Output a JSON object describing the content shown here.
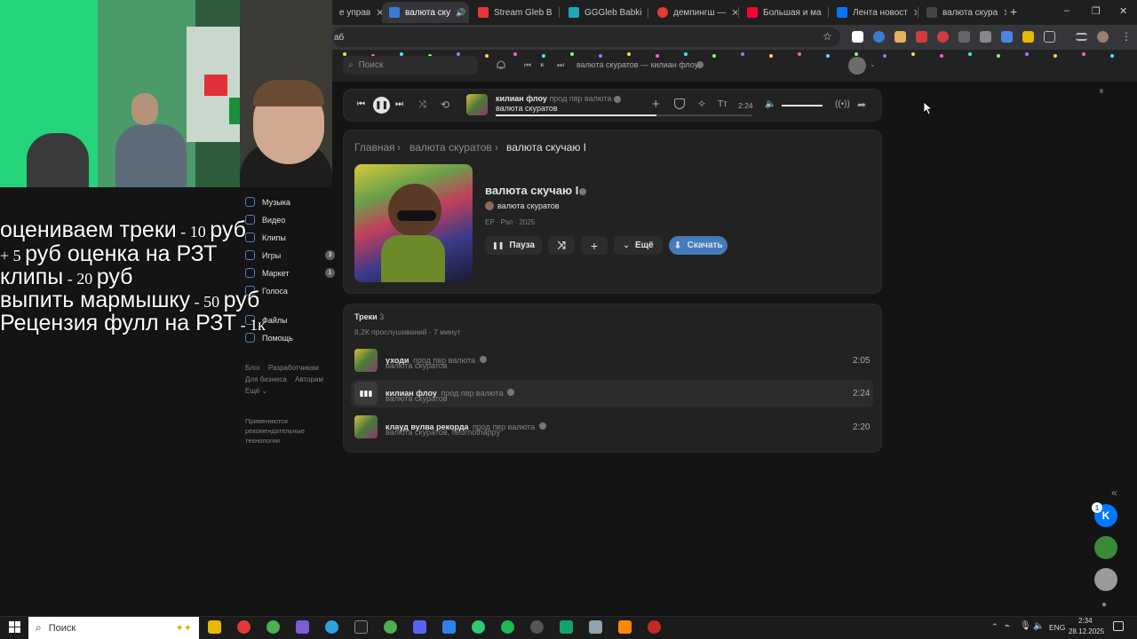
{
  "browser": {
    "tabs": [
      {
        "label": "е управ",
        "color": "#ffffff"
      },
      {
        "label": "валюта ску",
        "color": "#3a7bd5",
        "active": true
      },
      {
        "label": "Stream Gleb B",
        "color": "#e53935"
      },
      {
        "label": "GGGleb Babki",
        "color": "#1ea7b8"
      },
      {
        "label": "демпингш — ",
        "color": "#e53935"
      },
      {
        "label": "Большая и ма",
        "color": "#ff0033"
      },
      {
        "label": "Лента новост",
        "color": "#0077ff"
      },
      {
        "label": "валюта скура",
        "color": "#dddddd"
      }
    ],
    "new_tab": "+",
    "address": "аб",
    "window_controls": {
      "minimize": "–",
      "maximize": "❐",
      "close": "✕"
    }
  },
  "header": {
    "search_placeholder": "Поиск",
    "now_playing": "валюта скуратов — килиан флоу"
  },
  "player": {
    "title": "килиан флоу",
    "subtitle": "прод пвр валюта",
    "artist": "валюта скуратов",
    "time": "2:24",
    "tt_label": "Tт",
    "progress": 0.63,
    "volume": 1.0
  },
  "breadcrumb": {
    "home": "Главная",
    "artist": "валюта скуратов",
    "current": "валюта скучаю I"
  },
  "album": {
    "title": "валюта скучаю I",
    "artist": "валюта скуратов",
    "meta": "EP · Рэп · 2025",
    "pause_label": "Пауза",
    "more_label": "Ещё",
    "download_label": "Скачать"
  },
  "tracks": {
    "header": "Треки",
    "count": "3",
    "stats": "8,2К прослушиваний · 7 минут",
    "items": [
      {
        "title": "уходи",
        "feat": "прод пвр валюта",
        "artist": "валюта скуратов",
        "duration": "2:05"
      },
      {
        "title": "килиан флоу",
        "feat": "прод пвр валюта",
        "artist": "валюта скуратов",
        "duration": "2:24",
        "playing": true
      },
      {
        "title": "клауд вулва рекорда",
        "feat": "прод пвр валюта",
        "artist": "валюта скуратов, fleurnothappy",
        "duration": "2:20"
      }
    ]
  },
  "sidebar": {
    "items": [
      {
        "label": "Музыка"
      },
      {
        "label": "Видео"
      },
      {
        "label": "Клипы"
      },
      {
        "label": "Игры",
        "badge": "3"
      },
      {
        "label": "Маркет",
        "badge": "1"
      },
      {
        "label": "Голоса"
      },
      {
        "label": "Файлы"
      },
      {
        "label": "Помощь"
      }
    ],
    "footer_links": [
      "Блог",
      "Разработчикам",
      "Для бизнеса",
      "Авторам",
      "Ещё ⌄"
    ],
    "footer_note": "Применяются рекомендательные технологии"
  },
  "overlay": {
    "line1_a": "оцениваем треки",
    "line1_b": " - 10 ",
    "line1_c": "руб",
    "line2_a": "+ 5 ",
    "line2_b": "руб оценка на РЗТ",
    "line3_a": "клипы",
    "line3_b": " - 20 ",
    "line3_c": "руб",
    "line4_a": "выпить мармышку",
    "line4_b": " - 50 ",
    "line4_c": "руб",
    "line5_a": "Рецензия фулл на РЗТ",
    "line5_b": " - 1к"
  },
  "right_rail": {
    "vk_badge": "1",
    "collapse": "«"
  },
  "taskbar": {
    "search_placeholder": "Поиск",
    "lang": "ENG",
    "time": "2:34",
    "date": "28.12.2025"
  },
  "colors": {
    "accent": "#5181b8",
    "download": "#447bba",
    "bg": "#141414",
    "card": "#222222"
  }
}
